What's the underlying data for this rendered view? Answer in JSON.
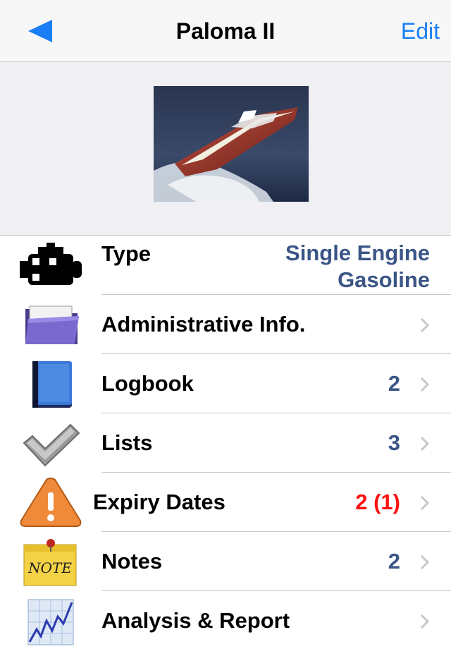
{
  "navbar": {
    "title": "Paloma II",
    "edit_label": "Edit",
    "accent_color": "#1a7ef5"
  },
  "header": {
    "photo_icon": "speedboat-photo"
  },
  "rows": [
    {
      "icon": "engine-icon",
      "label": "Type",
      "value_line1": "Single Engine",
      "value_line2": "Gasoline"
    },
    {
      "icon": "folder-icon",
      "label": "Administrative Info.",
      "value": ""
    },
    {
      "icon": "book-icon",
      "label": "Logbook",
      "value": "2"
    },
    {
      "icon": "checkmark-icon",
      "label": "Lists",
      "value": "3"
    },
    {
      "icon": "warning-icon",
      "label": "Expiry Dates",
      "value": "2 (1)",
      "value_color": "#ff1010"
    },
    {
      "icon": "note-icon",
      "label": "Notes",
      "value": "2"
    },
    {
      "icon": "chart-icon",
      "label": "Analysis & Report",
      "value": ""
    }
  ],
  "colors": {
    "value_blue": "#3b5587",
    "alert_red": "#ff1010",
    "chevron_gray": "#c7c7cc"
  }
}
